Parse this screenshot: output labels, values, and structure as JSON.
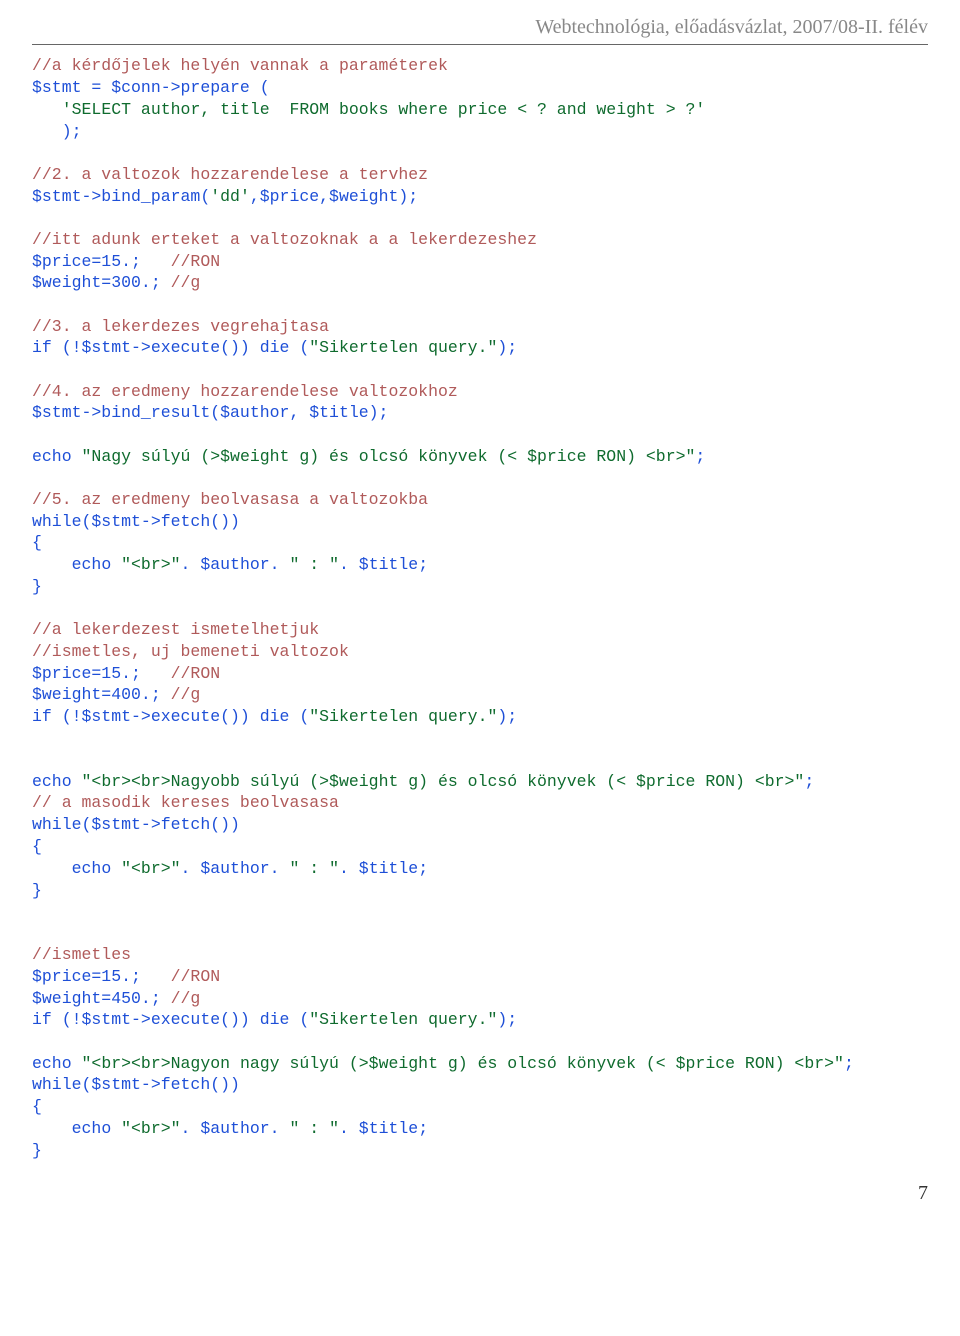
{
  "header": "Webtechnológia, előadásvázlat, 2007/08-II. félév",
  "page_number": "7",
  "lines": [
    [
      [
        "comment",
        "//a kérdőjelek helyén vannak a paraméterek"
      ]
    ],
    [
      [
        "kw",
        "$stmt = $conn->prepare ("
      ]
    ],
    [
      [
        "txt",
        "   "
      ],
      [
        "str",
        "'SELECT author, title  FROM books where price < ? and weight > ?'"
      ]
    ],
    [
      [
        "txt",
        "   "
      ],
      [
        "kw",
        ");"
      ]
    ],
    [
      [
        "blank",
        ""
      ]
    ],
    [
      [
        "comment",
        "//2. a valtozok hozzarendelese a tervhez"
      ]
    ],
    [
      [
        "kw",
        "$stmt->bind_param("
      ],
      [
        "str",
        "'dd'"
      ],
      [
        "kw",
        ",$price,$weight);"
      ]
    ],
    [
      [
        "blank",
        ""
      ]
    ],
    [
      [
        "comment",
        "//itt adunk erteket a valtozoknak a a lekerdezeshez"
      ]
    ],
    [
      [
        "kw",
        "$price=15.;   "
      ],
      [
        "comment",
        "//RON"
      ]
    ],
    [
      [
        "kw",
        "$weight=300.; "
      ],
      [
        "comment",
        "//g"
      ]
    ],
    [
      [
        "blank",
        ""
      ]
    ],
    [
      [
        "comment",
        "//3. a lekerdezes vegrehajtasa"
      ]
    ],
    [
      [
        "kw",
        "if (!$stmt->execute()) die ("
      ],
      [
        "str",
        "\"Sikertelen query.\""
      ],
      [
        "kw",
        ");"
      ]
    ],
    [
      [
        "blank",
        ""
      ]
    ],
    [
      [
        "comment",
        "//4. az eredmeny hozzarendelese valtozokhoz"
      ]
    ],
    [
      [
        "kw",
        "$stmt->bind_result($author, $title);"
      ]
    ],
    [
      [
        "blank",
        ""
      ]
    ],
    [
      [
        "kw",
        "echo "
      ],
      [
        "str",
        "\"Nagy súlyú (>$weight g) és olcsó könyvek (< $price RON) <br>\""
      ],
      [
        "kw",
        ";"
      ]
    ],
    [
      [
        "blank",
        ""
      ]
    ],
    [
      [
        "comment",
        "//5. az eredmeny beolvasasa a valtozokba"
      ]
    ],
    [
      [
        "kw",
        "while($stmt->fetch())"
      ]
    ],
    [
      [
        "kw",
        "{"
      ]
    ],
    [
      [
        "txt",
        "    "
      ],
      [
        "kw",
        "echo "
      ],
      [
        "str",
        "\"<br>\""
      ],
      [
        "kw",
        ". $author. "
      ],
      [
        "str",
        "\" : \""
      ],
      [
        "kw",
        ". $title;"
      ]
    ],
    [
      [
        "kw",
        "}"
      ]
    ],
    [
      [
        "blank",
        ""
      ]
    ],
    [
      [
        "comment",
        "//a lekerdezest ismetelhetjuk"
      ]
    ],
    [
      [
        "comment",
        "//ismetles, uj bemeneti valtozok"
      ]
    ],
    [
      [
        "kw",
        "$price=15.;   "
      ],
      [
        "comment",
        "//RON"
      ]
    ],
    [
      [
        "kw",
        "$weight=400.; "
      ],
      [
        "comment",
        "//g"
      ]
    ],
    [
      [
        "kw",
        "if (!$stmt->execute()) die ("
      ],
      [
        "str",
        "\"Sikertelen query.\""
      ],
      [
        "kw",
        ");"
      ]
    ],
    [
      [
        "blank",
        ""
      ]
    ],
    [
      [
        "blank",
        ""
      ]
    ],
    [
      [
        "kw",
        "echo "
      ],
      [
        "str",
        "\"<br><br>Nagyobb súlyú (>$weight g) és olcsó könyvek (< $price RON) <br>\""
      ],
      [
        "kw",
        ";"
      ]
    ],
    [
      [
        "comment",
        "// a masodik kereses beolvasasa"
      ]
    ],
    [
      [
        "kw",
        "while($stmt->fetch())"
      ]
    ],
    [
      [
        "kw",
        "{"
      ]
    ],
    [
      [
        "txt",
        "    "
      ],
      [
        "kw",
        "echo "
      ],
      [
        "str",
        "\"<br>\""
      ],
      [
        "kw",
        ". $author. "
      ],
      [
        "str",
        "\" : \""
      ],
      [
        "kw",
        ". $title;"
      ]
    ],
    [
      [
        "kw",
        "}"
      ]
    ],
    [
      [
        "blank",
        ""
      ]
    ],
    [
      [
        "blank",
        ""
      ]
    ],
    [
      [
        "comment",
        "//ismetles"
      ]
    ],
    [
      [
        "kw",
        "$price=15.;   "
      ],
      [
        "comment",
        "//RON"
      ]
    ],
    [
      [
        "kw",
        "$weight=450.; "
      ],
      [
        "comment",
        "//g"
      ]
    ],
    [
      [
        "kw",
        "if (!$stmt->execute()) die ("
      ],
      [
        "str",
        "\"Sikertelen query.\""
      ],
      [
        "kw",
        ");"
      ]
    ],
    [
      [
        "blank",
        ""
      ]
    ],
    [
      [
        "kw",
        "echo "
      ],
      [
        "str",
        "\"<br><br>Nagyon nagy súlyú (>$weight g) és olcsó könyvek (< $price RON) <br>\""
      ],
      [
        "kw",
        ";"
      ]
    ],
    [
      [
        "kw",
        "while($stmt->fetch())"
      ]
    ],
    [
      [
        "kw",
        "{"
      ]
    ],
    [
      [
        "txt",
        "    "
      ],
      [
        "kw",
        "echo "
      ],
      [
        "str",
        "\"<br>\""
      ],
      [
        "kw",
        ". $author. "
      ],
      [
        "str",
        "\" : \""
      ],
      [
        "kw",
        ". $title;"
      ]
    ],
    [
      [
        "kw",
        "}"
      ]
    ]
  ]
}
